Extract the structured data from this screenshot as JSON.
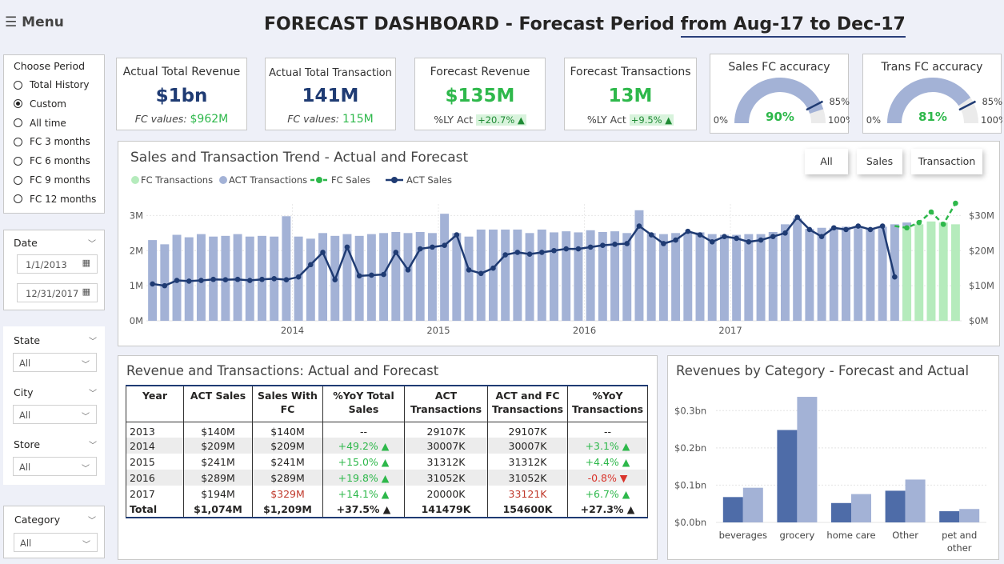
{
  "menu": {
    "label": "☰ Menu"
  },
  "header": {
    "title_a": "FORECAST DASHBOARD - Forecast Period ",
    "title_b": "from Aug-17 to Dec-17"
  },
  "period_slicer": {
    "title": "Choose Period",
    "options": [
      "Total History",
      "Custom",
      "All time",
      "FC 3 months",
      "FC 6 months",
      "FC 9 months",
      "FC 12 months"
    ],
    "selected": "Custom"
  },
  "date_slicer": {
    "title": "Date",
    "start": "1/1/2013",
    "end": "12/31/2017"
  },
  "filters": {
    "state": {
      "title": "State",
      "value": "All"
    },
    "city": {
      "title": "City",
      "value": "All"
    },
    "store": {
      "title": "Store",
      "value": "All"
    },
    "category": {
      "title": "Category",
      "value": "All"
    }
  },
  "kpis": {
    "actual_revenue": {
      "label": "Actual Total Revenue",
      "value": "$1bn",
      "sub_label": "FC values: ",
      "sub_value": "$962M"
    },
    "actual_transaction": {
      "label": "Actual Total Transaction",
      "value": "141M",
      "sub_label": "FC values: ",
      "sub_value": "115M"
    },
    "forecast_revenue": {
      "label": "Forecast Revenue",
      "value": "$135M",
      "sub_label": "%LY Act ",
      "sub_value": "+20.7% ▲"
    },
    "forecast_transactions": {
      "label": "Forecast Transactions",
      "value": "13M",
      "sub_label": "%LY Act ",
      "sub_value": "+9.5% ▲"
    }
  },
  "gauges": {
    "sales": {
      "title": "Sales FC accuracy",
      "value": 90,
      "value_label": "90%",
      "min_label": "0%",
      "max_label": "100%",
      "target": 85,
      "target_label": "85%"
    },
    "trans": {
      "title": "Trans FC accuracy",
      "value": 81,
      "value_label": "81%",
      "min_label": "0%",
      "max_label": "100%",
      "target": 85,
      "target_label": "85%"
    }
  },
  "trend": {
    "title": "Sales and Transaction Trend - Actual and Forecast",
    "buttons": [
      "All",
      "Sales",
      "Transaction"
    ],
    "legend": [
      "FC Transactions",
      "ACT Transactions",
      "FC Sales",
      "ACT Sales"
    ]
  },
  "table": {
    "title": "Revenue and Transactions: Actual and Forecast",
    "headers": [
      "Year",
      "ACT Sales",
      "Sales With FC",
      "%YoY Total Sales",
      "ACT Transactions",
      "ACT and FC Transactions",
      "%YoY Transactions"
    ],
    "rows": [
      [
        "2013",
        "$140M",
        "$140M",
        "--",
        "29107K",
        "29107K",
        "--"
      ],
      [
        "2014",
        "$209M",
        "$209M",
        "+49.2% ▲",
        "30007K",
        "30007K",
        "+3.1% ▲"
      ],
      [
        "2015",
        "$241M",
        "$241M",
        "+15.0% ▲",
        "31312K",
        "31312K",
        "+4.4% ▲"
      ],
      [
        "2016",
        "$289M",
        "$289M",
        "+19.8% ▲",
        "31052K",
        "31052K",
        "-0.8% ▼"
      ],
      [
        "2017",
        "$194M",
        "$329M",
        "+14.1% ▲",
        "20000K",
        "33121K",
        "+6.7% ▲"
      ]
    ],
    "total": [
      "Total",
      "$1,074M",
      "$1,209M",
      "+37.5% ▲",
      "141479K",
      "154600K",
      "+27.3% ▲"
    ]
  },
  "chart_data": [
    {
      "type": "bar",
      "title": "Sales and Transaction Trend - Actual and Forecast",
      "x_tick_labels": [
        "2014",
        "2015",
        "2016",
        "2017"
      ],
      "y_left_ticks": [
        "0M",
        "1M",
        "2M",
        "3M"
      ],
      "y_right_ticks": [
        "$0M",
        "$10M",
        "$20M",
        "$30M"
      ],
      "ylim_left": [
        0,
        3.1
      ],
      "ylim_right": [
        0,
        31
      ],
      "legend_position": "top-left",
      "colors": {
        "act_bar": "#a3b2d6",
        "fc_bar": "#b5ebbc",
        "act_line": "#1f3b73",
        "fc_line": "#2eb84b"
      },
      "series": [
        {
          "name": "ACT Transactions",
          "kind": "bar",
          "start_index": 0,
          "values": [
            2.3,
            2.18,
            2.45,
            2.38,
            2.47,
            2.4,
            2.42,
            2.47,
            2.4,
            2.42,
            2.4,
            2.98,
            2.4,
            2.34,
            2.5,
            2.42,
            2.47,
            2.42,
            2.47,
            2.5,
            2.53,
            2.5,
            2.53,
            2.5,
            3.05,
            2.5,
            2.4,
            2.6,
            2.6,
            2.6,
            2.6,
            2.5,
            2.6,
            2.52,
            2.55,
            2.52,
            2.58,
            2.53,
            2.55,
            2.5,
            3.15,
            2.5,
            2.47,
            2.5,
            2.52,
            2.52,
            2.47,
            2.45,
            2.45,
            2.47,
            2.47,
            2.53,
            2.75,
            2.92,
            2.62,
            2.65,
            2.65,
            2.68,
            2.68,
            2.65,
            2.68,
            2.75,
            2.8
          ]
        },
        {
          "name": "FC Transactions",
          "kind": "bar",
          "start_index": 62,
          "values": [
            2.7,
            2.75,
            2.83,
            2.8,
            2.75
          ]
        },
        {
          "name": "ACT Sales",
          "kind": "line",
          "start_index": 0,
          "values": [
            10.5,
            10,
            11.5,
            11.3,
            11.5,
            11.8,
            11.7,
            11.8,
            11.5,
            11.8,
            12,
            11.7,
            12.5,
            16,
            19.5,
            11.7,
            21,
            12.8,
            13,
            13.2,
            19.5,
            14.5,
            20.5,
            21,
            21.5,
            24.5,
            14.5,
            13.5,
            15,
            18.8,
            19.5,
            19,
            19.5,
            20,
            20.5,
            20.5,
            21,
            21.5,
            21.8,
            22,
            27,
            24.5,
            22,
            23,
            25.5,
            24.5,
            22.5,
            24,
            23.5,
            22.5,
            23,
            24,
            25,
            29.5,
            26,
            24,
            26.5,
            26,
            27,
            26,
            27,
            12.5
          ]
        },
        {
          "name": "FC Sales",
          "kind": "line",
          "dashed": true,
          "start_index": 61,
          "values": [
            27,
            26.5,
            28,
            31,
            27.5,
            33.5
          ]
        }
      ]
    },
    {
      "type": "bar",
      "title": "Revenues by Category - Forecast and Actual",
      "categories": [
        "beverages",
        "grocery",
        "home care",
        "Other",
        "pet and other"
      ],
      "series": [
        {
          "values": [
            0.068,
            0.248,
            0.052,
            0.085,
            0.03
          ],
          "color": "#4e6ca8"
        },
        {
          "values": [
            0.093,
            0.337,
            0.076,
            0.115,
            0.036
          ],
          "color": "#a3b2d6"
        }
      ],
      "y_ticks": [
        "$0.0bn",
        "$0.1bn",
        "$0.2bn",
        "$0.3bn"
      ],
      "ylim": [
        0,
        0.35
      ]
    }
  ]
}
